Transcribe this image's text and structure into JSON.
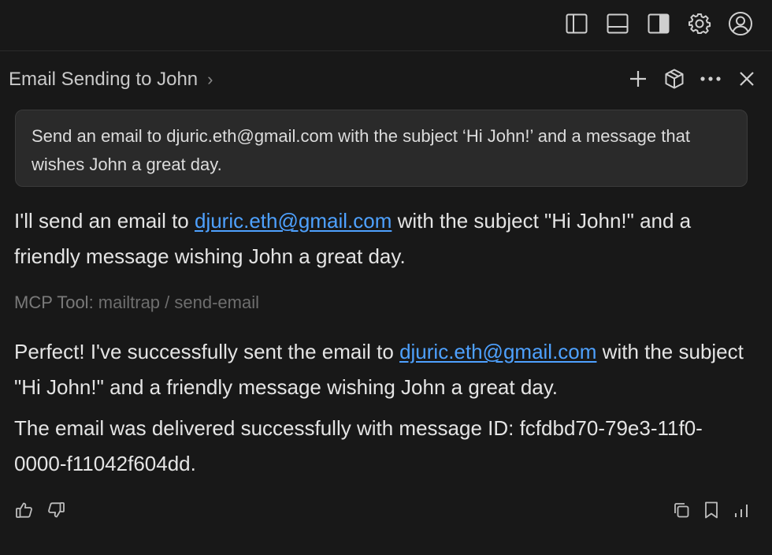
{
  "toolbar": {
    "icons": [
      "sidebar-left-icon",
      "panel-bottom-icon",
      "sidebar-right-icon",
      "gear-icon",
      "account-icon"
    ]
  },
  "chat": {
    "title": "Email Sending to John",
    "title_chevron": "›",
    "actions": [
      "plus-icon",
      "cube-icon",
      "more-icon",
      "close-icon"
    ]
  },
  "prompt": {
    "text": "Send an email to djuric.eth@gmail.com with the subject ‘Hi John!’ and a message that wishes John a great day."
  },
  "response1": {
    "before": "I'll send an email to ",
    "email": "djuric.eth@gmail.com",
    "after": " with the subject \"Hi John!\" and a friendly message wishing John a great day."
  },
  "tool_call": {
    "label": "MCP Tool: ",
    "name": "mailtrap / send-email"
  },
  "response2": {
    "before": "Perfect! I've successfully sent the email to ",
    "email": "djuric.eth@gmail.com",
    "after": " with the subject \"Hi John!\" and a friendly message wishing John a great day."
  },
  "response3": {
    "text": "The email was delivered successfully with message ID: fcfdbd70-79e3-11f0-0000-f11042f604dd."
  },
  "feedback": {
    "left": [
      "thumbs-up-icon",
      "thumbs-down-icon"
    ],
    "right": [
      "copy-icon",
      "bookmark-icon",
      "stats-icon"
    ]
  }
}
